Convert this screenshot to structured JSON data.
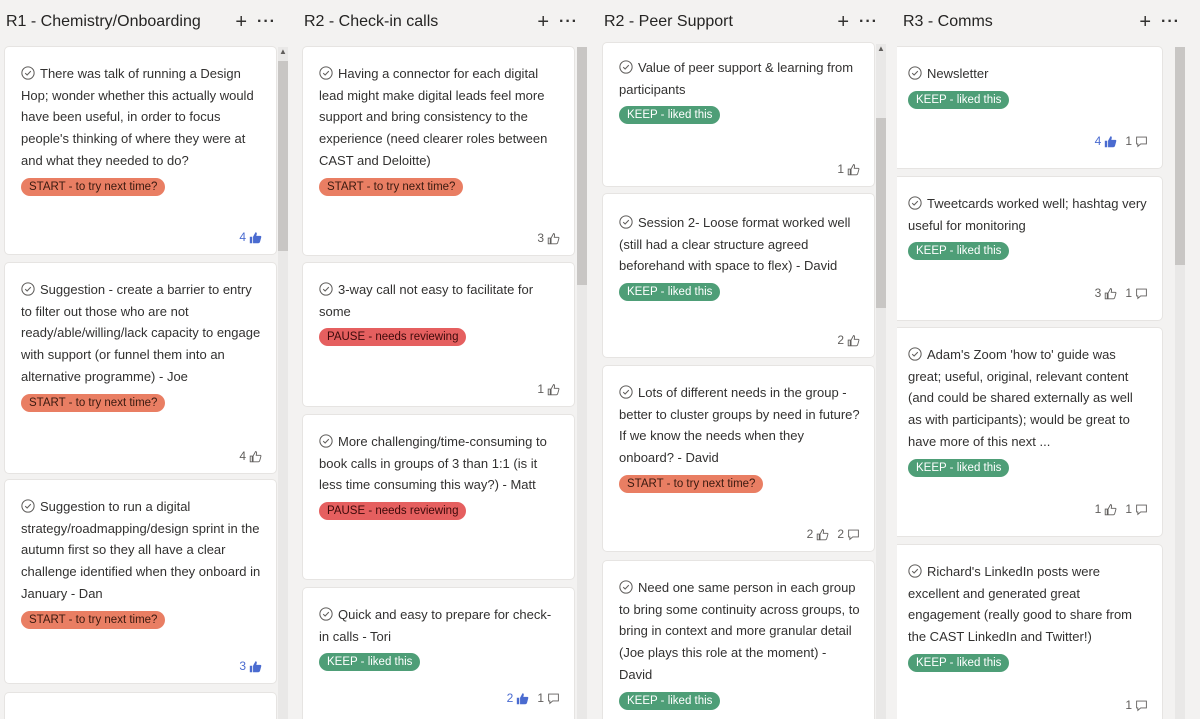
{
  "columns": [
    {
      "title": "R1 - Chemistry/Onboarding",
      "cards": [
        {
          "text": "There was talk of running a Design Hop; wonder whether this actually would have been useful, in order to focus people's thinking of where they were at and what they needed to do?",
          "badge": "START - to try next time?",
          "likes": "4",
          "liked": true,
          "comments": ""
        },
        {
          "text": "Suggestion - create a barrier to entry to filter out those who are not ready/able/willing/lack capacity to engage with support (or funnel them into an alternative programme) - Joe",
          "badge": "START - to try next time?",
          "likes": "4",
          "liked": false,
          "comments": ""
        },
        {
          "text": "Suggestion to run a digital strategy/roadmapping/design sprint in the autumn first so they all have a clear challenge identified when they onboard in January - Dan",
          "badge": "START - to try next time?",
          "likes": "3",
          "liked": true,
          "comments": ""
        }
      ]
    },
    {
      "title": "R2 - Check-in calls",
      "cards": [
        {
          "text": "Having a connector for each digital lead might make digital leads feel more support and bring consistency to the experience (need clearer roles between CAST and Deloitte)",
          "badge": "START - to try next time?",
          "likes": "3",
          "liked": false,
          "comments": ""
        },
        {
          "text": "3-way call not easy to facilitate for some",
          "badge": "PAUSE - needs reviewing",
          "likes": "1",
          "liked": false,
          "comments": ""
        },
        {
          "text": "More challenging/time-consuming to book calls in groups of 3 than 1:1 (is it less time consuming this way?) - Matt",
          "badge": "PAUSE - needs reviewing",
          "likes": "",
          "liked": false,
          "comments": ""
        },
        {
          "text": "Quick and easy to prepare for check-in calls - Tori",
          "badge": "KEEP - liked this",
          "likes": "2",
          "liked": true,
          "comments": "1"
        }
      ]
    },
    {
      "title": "R2 - Peer Support",
      "cards": [
        {
          "text": "Value of peer support & learning from participants",
          "badge": "KEEP - liked this",
          "likes": "1",
          "liked": false,
          "comments": ""
        },
        {
          "text": "Session 2- Loose format worked well (still had a clear structure agreed beforehand with space to flex) - David",
          "badge": "KEEP - liked this",
          "likes": "2",
          "liked": false,
          "comments": ""
        },
        {
          "text": "Lots of different needs in the group - better to cluster groups by need in future? If we know the needs when they onboard? - David",
          "badge": "START - to try next time?",
          "likes": "2",
          "liked": false,
          "comments": "2"
        },
        {
          "text": "Need one same person in each group to bring some continuity across groups, to bring in context and more granular detail (Joe plays this role at the moment) - David",
          "badge": "KEEP - liked this",
          "likes": "",
          "liked": false,
          "comments": ""
        }
      ]
    },
    {
      "title": "R3 - Comms",
      "cards": [
        {
          "text": "Newsletter",
          "badge": "KEEP - liked this",
          "likes": "4",
          "liked": true,
          "comments": "1"
        },
        {
          "text": "Tweetcards worked well; hashtag very useful for monitoring",
          "badge": "KEEP - liked this",
          "likes": "3",
          "liked": false,
          "comments": "1"
        },
        {
          "text": "Adam's Zoom 'how to' guide was great; useful, original, relevant content (and could be shared externally as well as with participants); would be great to have more of this next ...",
          "badge": "KEEP - liked this",
          "likes": "1",
          "liked": false,
          "comments": "1"
        },
        {
          "text": "Richard's LinkedIn posts were excellent and generated great engagement (really good to share from the CAST LinkedIn and Twitter!)",
          "badge": "KEEP - liked this",
          "likes": "",
          "liked": false,
          "comments": "1"
        }
      ]
    }
  ],
  "icons": {
    "add": "plus-icon",
    "more": "more-icon",
    "check": "check-circle-icon",
    "like": "thumbs-up-icon",
    "comment": "comment-icon"
  },
  "colors": {
    "start": "#e97e63",
    "pause": "#e55f5f",
    "keep": "#4e9e77",
    "liked": "#4a6bd0"
  }
}
